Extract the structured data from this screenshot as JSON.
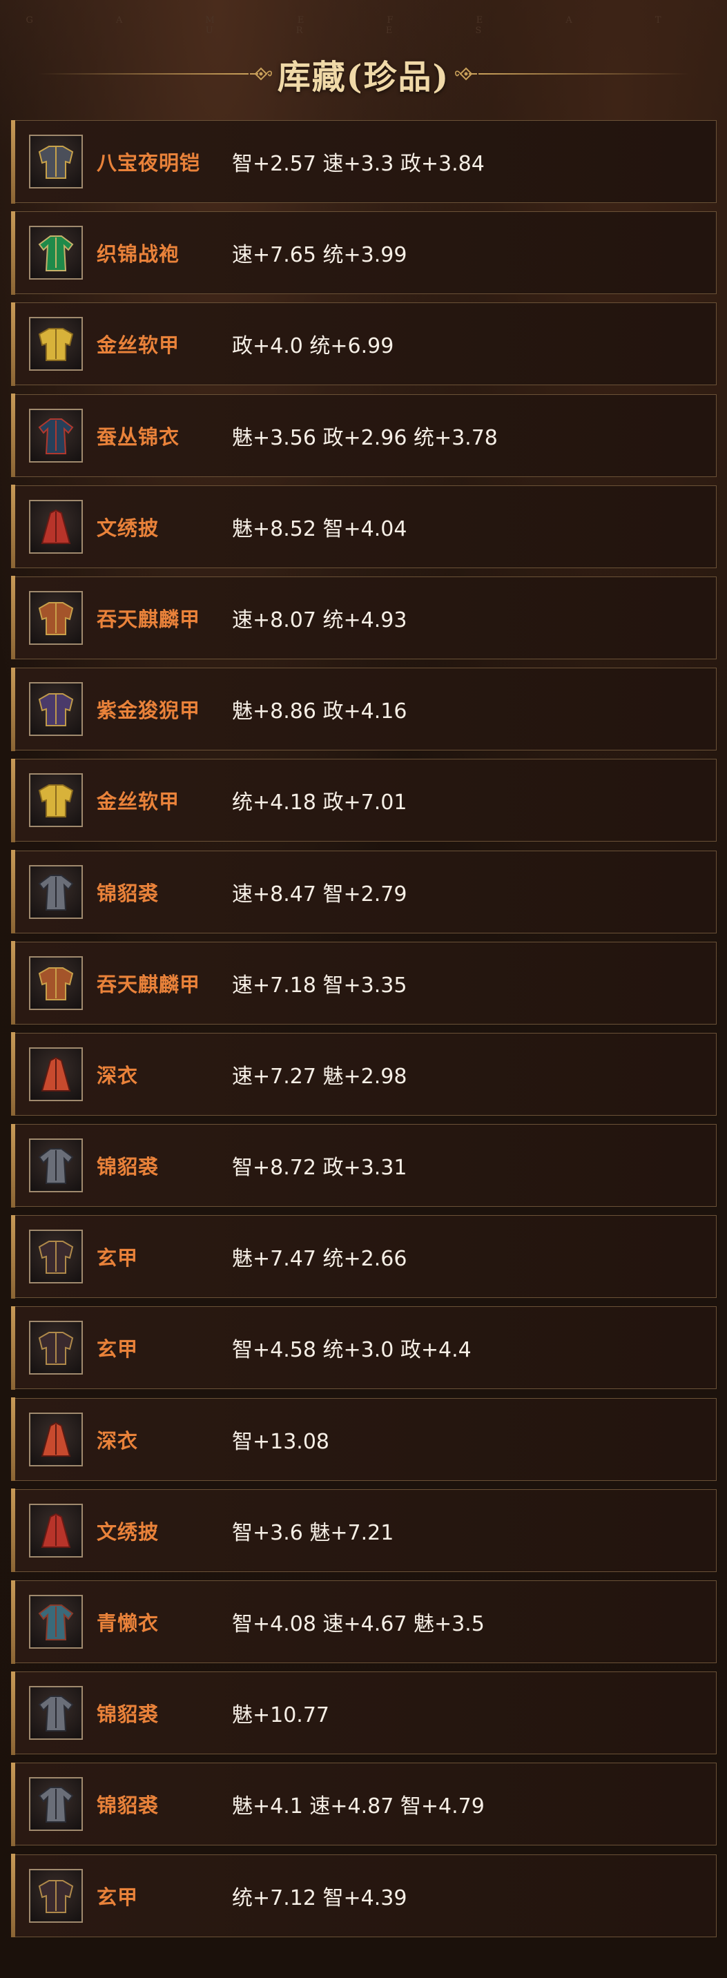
{
  "header": {
    "watermark": "G A M E   F E A T U R E S",
    "title": "库藏(珍品)"
  },
  "items": [
    {
      "name": "八宝夜明铠",
      "stats": "智+2.57 速+3.3 政+3.84",
      "icon": "armor-icon",
      "colors": [
        "#4b4f5a",
        "#c8a24a"
      ]
    },
    {
      "name": "织锦战袍",
      "stats": "速+7.65 统+3.99",
      "icon": "robe-icon",
      "colors": [
        "#1f8a4a",
        "#c7b26a"
      ]
    },
    {
      "name": "金丝软甲",
      "stats": "政+4.0 统+6.99",
      "icon": "golden-armor-icon",
      "colors": [
        "#d8b23a",
        "#8a6a1e"
      ]
    },
    {
      "name": "蚕丛锦衣",
      "stats": "魅+3.56 政+2.96 统+3.78",
      "icon": "silk-robe-icon",
      "colors": [
        "#27405a",
        "#b0382e"
      ]
    },
    {
      "name": "文绣披",
      "stats": "魅+8.52 智+4.04",
      "icon": "cape-icon",
      "colors": [
        "#b8342a",
        "#6a1a14"
      ]
    },
    {
      "name": "吞天麒麟甲",
      "stats": "速+8.07 统+4.93",
      "icon": "qilin-armor-icon",
      "colors": [
        "#a4542a",
        "#c9a04a"
      ]
    },
    {
      "name": "紫金狻猊甲",
      "stats": "魅+8.86 政+4.16",
      "icon": "purple-armor-icon",
      "colors": [
        "#4a3a6a",
        "#c09a4a"
      ]
    },
    {
      "name": "金丝软甲",
      "stats": "统+4.18 政+7.01",
      "icon": "golden-armor-icon",
      "colors": [
        "#d8b23a",
        "#8a6a1e"
      ]
    },
    {
      "name": "锦貂裘",
      "stats": "速+8.47 智+2.79",
      "icon": "fur-coat-icon",
      "colors": [
        "#6a6e78",
        "#2a2c34"
      ]
    },
    {
      "name": "吞天麒麟甲",
      "stats": "速+7.18 智+3.35",
      "icon": "qilin-armor-icon",
      "colors": [
        "#a4542a",
        "#c9a04a"
      ]
    },
    {
      "name": "深衣",
      "stats": "速+7.27 魅+2.98",
      "icon": "deep-robe-icon",
      "colors": [
        "#c84a2e",
        "#5a1a12"
      ]
    },
    {
      "name": "锦貂裘",
      "stats": "智+8.72 政+3.31",
      "icon": "fur-coat-icon",
      "colors": [
        "#6a6e78",
        "#2a2c34"
      ]
    },
    {
      "name": "玄甲",
      "stats": "魅+7.47 统+2.66",
      "icon": "black-armor-icon",
      "colors": [
        "#3a2a2e",
        "#b08a4a"
      ]
    },
    {
      "name": "玄甲",
      "stats": "智+4.58 统+3.0 政+4.4",
      "icon": "black-armor-icon",
      "colors": [
        "#3a2a2e",
        "#b08a4a"
      ]
    },
    {
      "name": "深衣",
      "stats": "智+13.08",
      "icon": "deep-robe-icon",
      "colors": [
        "#c84a2e",
        "#5a1a12"
      ]
    },
    {
      "name": "文绣披",
      "stats": "智+3.6 魅+7.21",
      "icon": "cape-icon",
      "colors": [
        "#b8342a",
        "#6a1a14"
      ]
    },
    {
      "name": "青懒衣",
      "stats": "智+4.08 速+4.67 魅+3.5",
      "icon": "blue-robe-icon",
      "colors": [
        "#3a6a7a",
        "#8a3a2a"
      ]
    },
    {
      "name": "锦貂裘",
      "stats": "魅+10.77",
      "icon": "fur-coat-icon",
      "colors": [
        "#6a6e78",
        "#2a2c34"
      ]
    },
    {
      "name": "锦貂裘",
      "stats": "魅+4.1 速+4.87 智+4.79",
      "icon": "fur-coat-icon",
      "colors": [
        "#6a6e78",
        "#2a2c34"
      ]
    },
    {
      "name": "玄甲",
      "stats": "统+7.12 智+4.39",
      "icon": "black-armor-icon",
      "colors": [
        "#3a2a2e",
        "#b08a4a"
      ]
    }
  ]
}
